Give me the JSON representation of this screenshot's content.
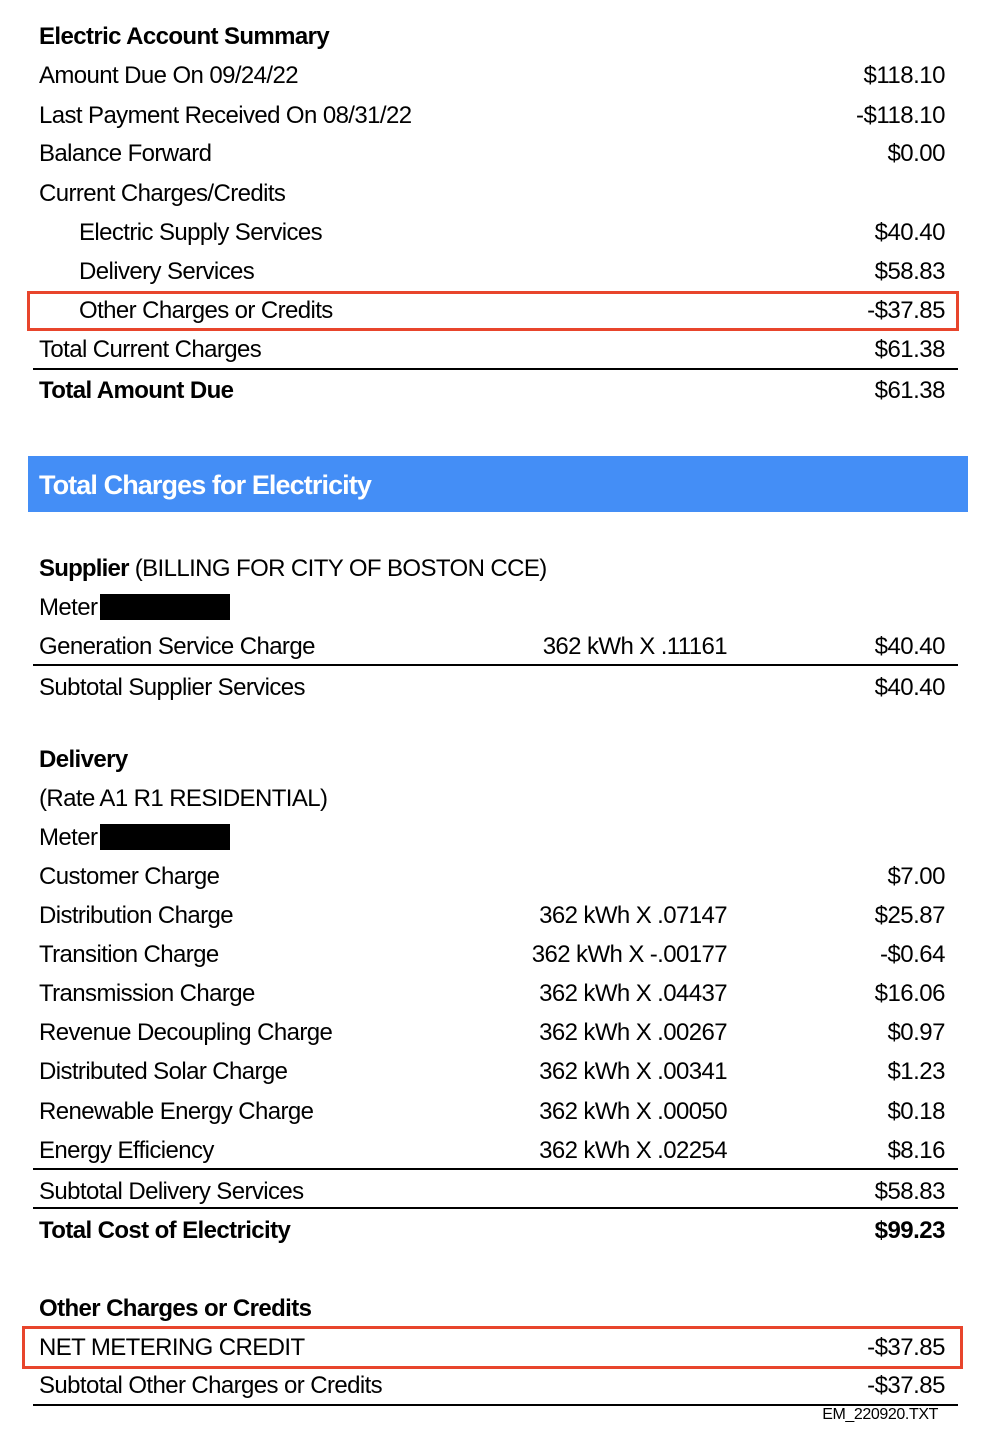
{
  "account_summary": {
    "title": "Electric Account Summary",
    "rows": [
      {
        "label": "Amount Due On 09/24/22",
        "amount": "$118.10"
      },
      {
        "label": "Last Payment Received On 08/31/22",
        "amount": "-$118.10"
      },
      {
        "label": "Balance Forward",
        "amount": "$0.00"
      },
      {
        "label": "Current Charges/Credits",
        "amount": ""
      },
      {
        "label": "Electric Supply Services",
        "amount": "$40.40"
      },
      {
        "label": "Delivery Services",
        "amount": "$58.83"
      },
      {
        "label": "Other Charges or Credits",
        "amount": "-$37.85",
        "highlighted": true
      },
      {
        "label": "Total Current Charges",
        "amount": "$61.38"
      }
    ],
    "total": {
      "label": "Total Amount Due",
      "amount": "$61.38"
    }
  },
  "charges_banner": {
    "title": "Total Charges for Electricity",
    "color": "#448ef6"
  },
  "supplier": {
    "heading": "Supplier",
    "heading_detail": "(BILLING FOR CITY OF BOSTON CCE)",
    "meter_label": "Meter",
    "meter_value": "[redacted]",
    "items": [
      {
        "label": "Generation Service Charge",
        "calc": "362 kWh X .11161",
        "amount": "$40.40"
      }
    ],
    "subtotal": {
      "label": "Subtotal Supplier Services",
      "amount": "$40.40"
    }
  },
  "delivery": {
    "heading": "Delivery",
    "rate": "(Rate A1 R1 RESIDENTIAL)",
    "meter_label": "Meter",
    "meter_value": "[redacted]",
    "items": [
      {
        "label": "Customer Charge",
        "calc": "",
        "amount": "$7.00"
      },
      {
        "label": "Distribution Charge",
        "calc": "362 kWh X .07147",
        "amount": "$25.87"
      },
      {
        "label": "Transition Charge",
        "calc": "362 kWh X -.00177",
        "amount": "-$0.64"
      },
      {
        "label": "Transmission Charge",
        "calc": "362 kWh X .04437",
        "amount": "$16.06"
      },
      {
        "label": "Revenue Decoupling Charge",
        "calc": "362 kWh X .00267",
        "amount": "$0.97"
      },
      {
        "label": "Distributed Solar Charge",
        "calc": "362 kWh X .00341",
        "amount": "$1.23"
      },
      {
        "label": "Renewable Energy Charge",
        "calc": "362 kWh X .00050",
        "amount": "$0.18"
      },
      {
        "label": "Energy Efficiency",
        "calc": "362 kWh X .02254",
        "amount": "$8.16"
      }
    ],
    "subtotal": {
      "label": "Subtotal Delivery Services",
      "amount": "$58.83"
    },
    "total_cost": {
      "label": "Total Cost of Electricity",
      "amount": "$99.23"
    }
  },
  "other_charges": {
    "heading": "Other Charges or Credits",
    "items": [
      {
        "label": "NET METERING CREDIT",
        "amount": "-$37.85",
        "highlighted": true
      }
    ],
    "subtotal": {
      "label": "Subtotal Other Charges or Credits",
      "amount": "-$37.85"
    }
  },
  "footer": {
    "file_name": "EM_220920.TXT"
  },
  "colors": {
    "highlight_border": "#e8452c",
    "banner": "#448ef6"
  }
}
